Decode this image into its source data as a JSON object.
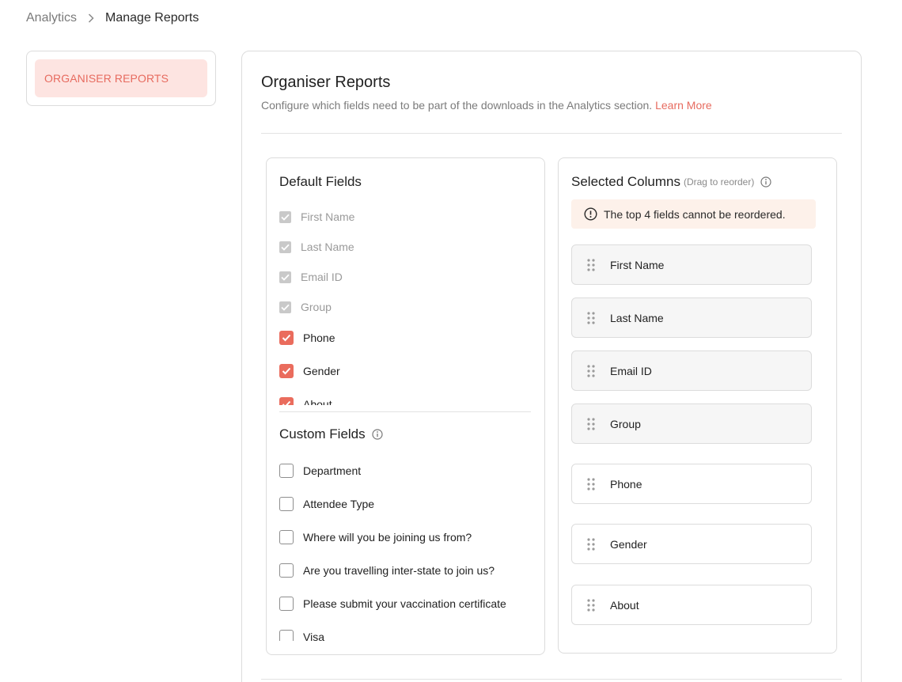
{
  "breadcrumb": {
    "parent": "Analytics",
    "current": "Manage Reports"
  },
  "sidebar": {
    "items": [
      {
        "label": "ORGANISER REPORTS",
        "active": true
      }
    ]
  },
  "main": {
    "title": "Organiser Reports",
    "description": "Configure which fields need to be part of the downloads in the Analytics section.",
    "learn_more": "Learn More"
  },
  "default_fields": {
    "title": "Default Fields",
    "items": [
      {
        "label": "First Name",
        "state": "disabled-checked"
      },
      {
        "label": "Last Name",
        "state": "disabled-checked"
      },
      {
        "label": "Email ID",
        "state": "disabled-checked"
      },
      {
        "label": "Group",
        "state": "disabled-checked"
      },
      {
        "label": "Phone",
        "state": "checked"
      },
      {
        "label": "Gender",
        "state": "checked"
      },
      {
        "label": "About",
        "state": "checked"
      }
    ]
  },
  "custom_fields": {
    "title": "Custom Fields",
    "items": [
      {
        "label": "Department",
        "state": "unchecked"
      },
      {
        "label": "Attendee Type",
        "state": "unchecked"
      },
      {
        "label": "Where will you be joining us from?",
        "state": "unchecked"
      },
      {
        "label": "Are you travelling inter-state to join us?",
        "state": "unchecked"
      },
      {
        "label": "Please submit your vaccination certificate",
        "state": "unchecked"
      },
      {
        "label": "Visa",
        "state": "unchecked"
      }
    ]
  },
  "selected_columns": {
    "title": "Selected Columns",
    "hint": "(Drag to reorder)",
    "notice": "The top 4 fields cannot be reordered.",
    "items": [
      {
        "label": "First Name",
        "locked": true
      },
      {
        "label": "Last Name",
        "locked": true
      },
      {
        "label": "Email ID",
        "locked": true
      },
      {
        "label": "Group",
        "locked": true
      },
      {
        "label": "Phone",
        "locked": false
      },
      {
        "label": "Gender",
        "locked": false
      },
      {
        "label": "About",
        "locked": false
      }
    ]
  },
  "colors": {
    "accent": "#ea6c5d",
    "active_bg": "#fde4e1",
    "notice_bg": "#fdf1ea",
    "disabled": "#c9c9c9"
  },
  "icons": {
    "breadcrumb_separator": "chevron-right-icon",
    "info": "info-icon",
    "notice": "alert-circle-icon",
    "drag": "drag-handle-icon",
    "check": "checkmark-icon"
  }
}
